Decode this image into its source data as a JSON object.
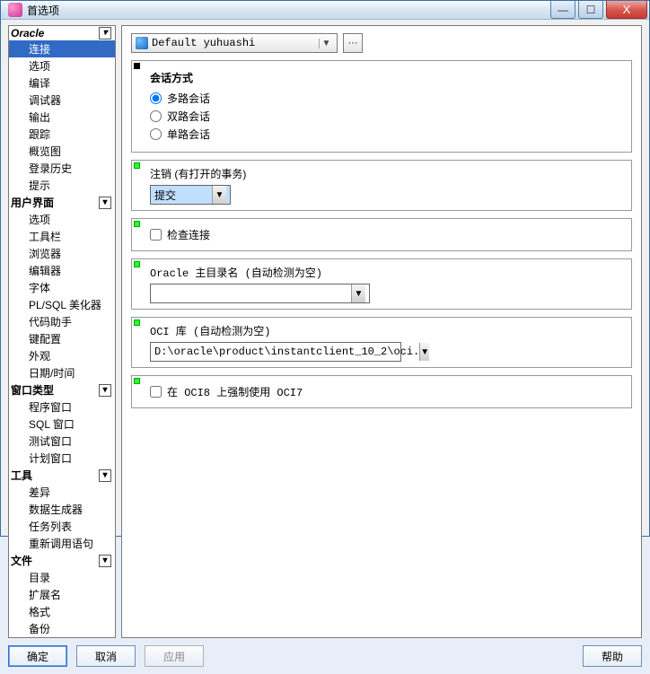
{
  "window": {
    "title": "首选项"
  },
  "titlebar": {
    "min": "—",
    "max": "☐",
    "close": "X"
  },
  "tree": {
    "oracle": {
      "label": "Oracle",
      "items": [
        "连接",
        "选项",
        "编译",
        "调试器",
        "输出",
        "跟踪",
        "概览图",
        "登录历史",
        "提示"
      ]
    },
    "ui": {
      "label": "用户界面",
      "items": [
        "选项",
        "工具栏",
        "浏览器",
        "编辑器",
        "字体",
        "PL/SQL 美化器",
        "代码助手",
        "键配置",
        "外观",
        "日期/时间"
      ]
    },
    "wintype": {
      "label": "窗口类型",
      "items": [
        "程序窗口",
        "SQL 窗口",
        "测试窗口",
        "计划窗口"
      ]
    },
    "tools": {
      "label": "工具",
      "items": [
        "差异",
        "数据生成器",
        "任务列表",
        "重新调用语句"
      ]
    },
    "files": {
      "label": "文件",
      "items": [
        "目录",
        "扩展名",
        "格式",
        "备份"
      ]
    },
    "selected_index": 0,
    "expander": "▾"
  },
  "profile": {
    "value": "Default yuhuashi",
    "more": "···"
  },
  "session_mode": {
    "title": "会话方式",
    "options": [
      "多路会话",
      "双路会话",
      "单路会话"
    ],
    "selected": 0
  },
  "logout": {
    "label": "注销 (有打开的事务)",
    "value": "提交"
  },
  "check_conn": {
    "label": "检查连接",
    "checked": false
  },
  "oracle_home": {
    "label": "Oracle 主目录名 (自动检测为空)",
    "value": ""
  },
  "oci_lib": {
    "label": "OCI 库 (自动检测为空)",
    "value": "D:\\oracle\\product\\instantclient_10_2\\oci."
  },
  "force_oci7": {
    "label": "在 OCI8 上强制使用 OCI7",
    "checked": false
  },
  "buttons": {
    "ok": "确定",
    "cancel": "取消",
    "apply": "应用",
    "help": "帮助"
  }
}
